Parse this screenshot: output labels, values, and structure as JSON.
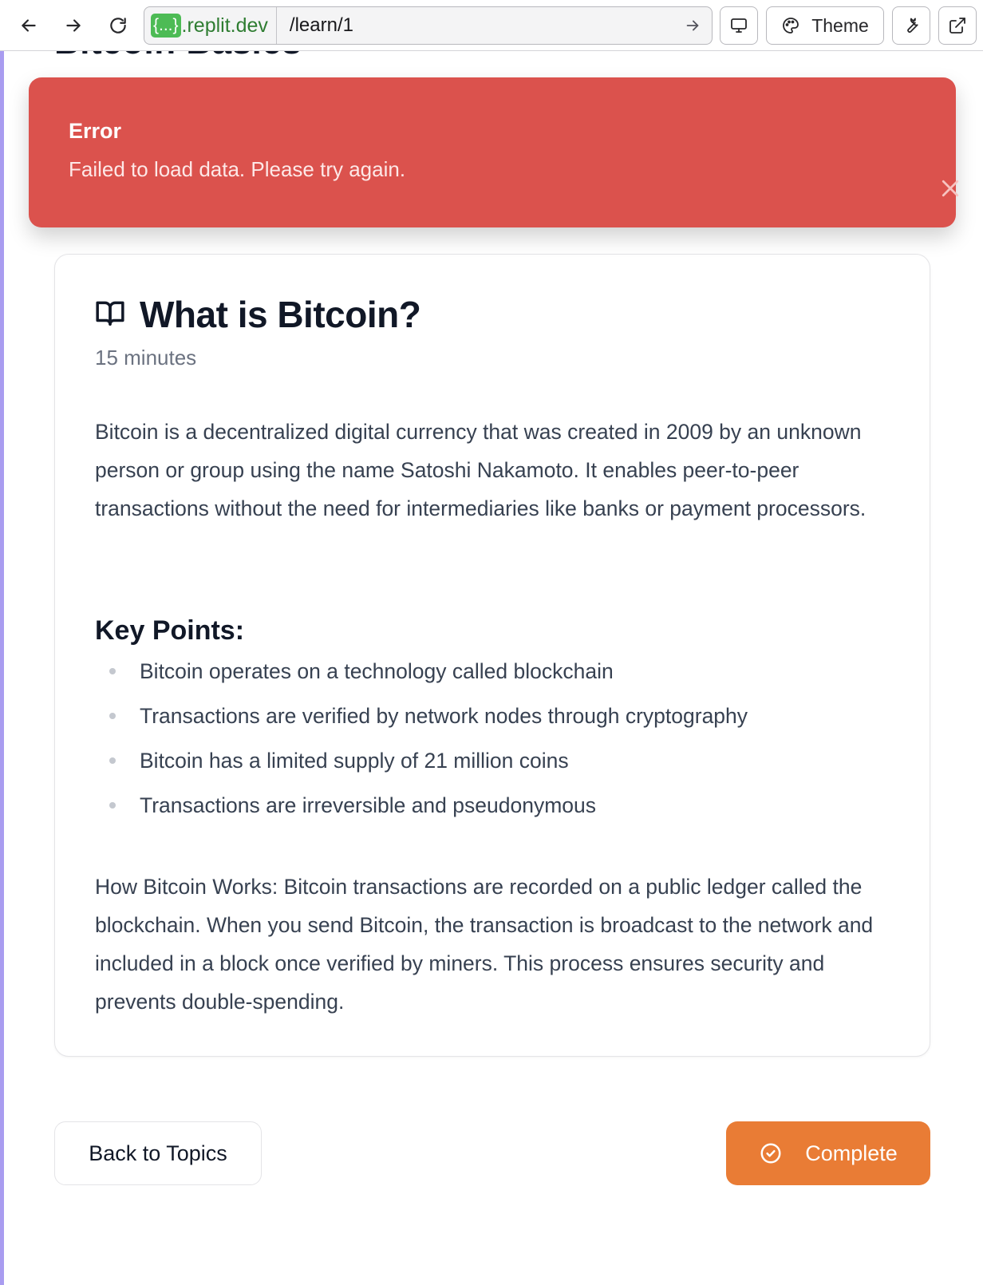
{
  "browser": {
    "url_host_chip": "{...}",
    "url_host": ".replit.dev",
    "url_path": "/learn/1",
    "theme_label": "Theme"
  },
  "page": {
    "heading": "Bitcoin Basics"
  },
  "toast": {
    "title": "Error",
    "message": "Failed to load data. Please try again.",
    "color": "#db524d"
  },
  "lesson": {
    "title": "What is Bitcoin?",
    "duration": "15 minutes",
    "intro": "Bitcoin is a decentralized digital currency that was created in 2009 by an unknown person or group using the name Satoshi Nakamoto. It enables peer-to-peer transactions without the need for intermediaries like banks or payment processors.",
    "key_points_heading": "Key Points:",
    "key_points": [
      "Bitcoin operates on a technology called blockchain",
      "Transactions are verified by network nodes through cryptography",
      "Bitcoin has a limited supply of 21 million coins",
      "Transactions are irreversible and pseudonymous"
    ],
    "how_it_works": "How Bitcoin Works: Bitcoin transactions are recorded on a public ledger called the blockchain. When you send Bitcoin, the transaction is broadcast to the network and included in a block once verified by miners. This process ensures security and prevents double-spending."
  },
  "actions": {
    "back_label": "Back to Topics",
    "complete_label": "Complete",
    "complete_color": "#e97c35"
  },
  "icons": [
    "arrow-left-icon",
    "arrow-right-icon",
    "reload-icon",
    "go-arrow-icon",
    "monitor-icon",
    "palette-icon",
    "wrench-icon",
    "external-link-icon",
    "close-icon",
    "book-open-icon",
    "check-circle-icon"
  ]
}
